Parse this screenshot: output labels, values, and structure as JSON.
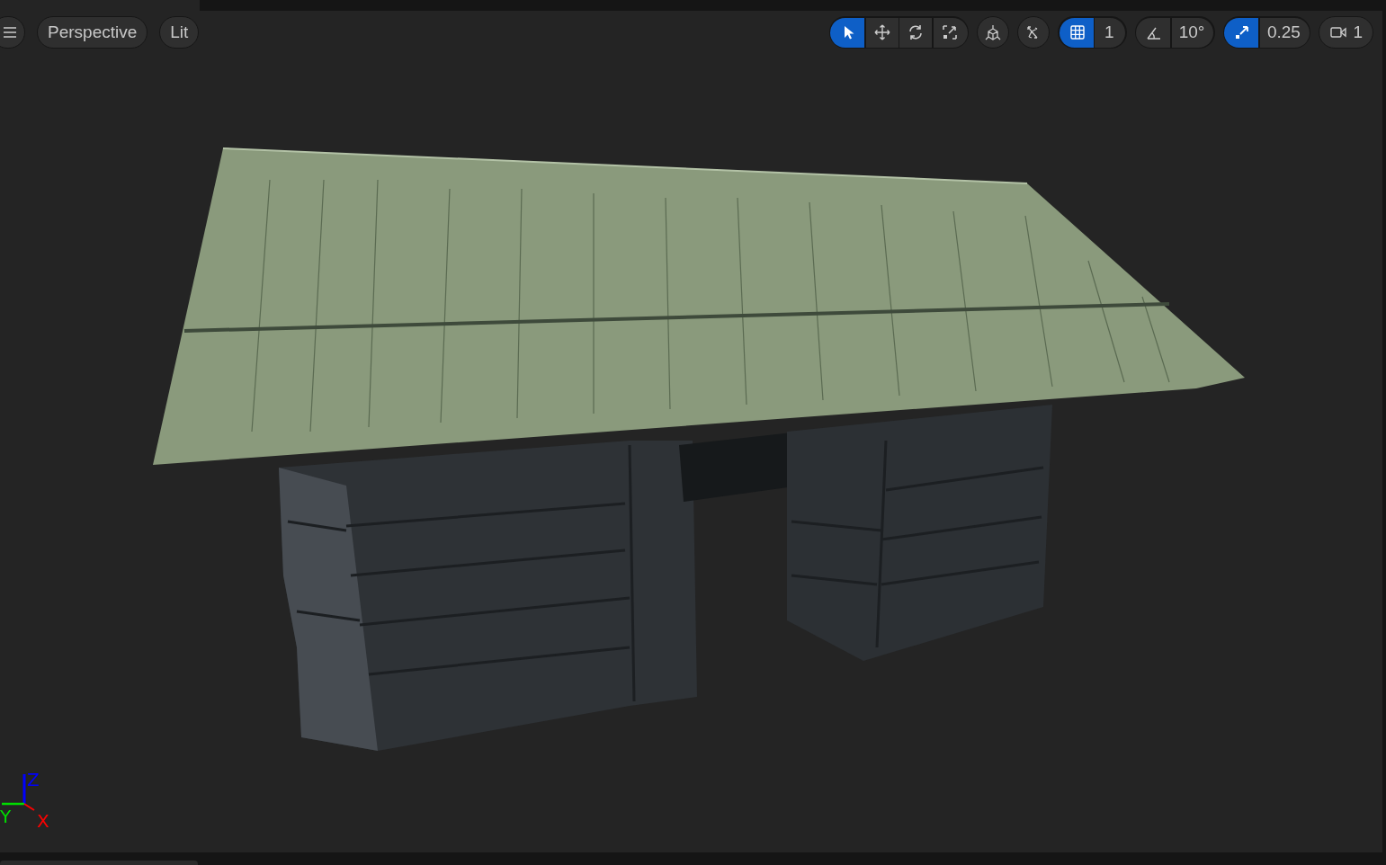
{
  "toolbar": {
    "left": [
      {
        "kind": "menu"
      },
      {
        "kind": "text",
        "label": "Perspective"
      },
      {
        "kind": "text",
        "label": "Lit"
      }
    ],
    "transform_tools": [
      {
        "kind": "select",
        "selected": true
      },
      {
        "kind": "move",
        "selected": false
      },
      {
        "kind": "rotate",
        "selected": false
      },
      {
        "kind": "scale",
        "selected": false
      }
    ],
    "extra_tools": [
      {
        "kind": "cube-axes"
      },
      {
        "kind": "scatter-arrows"
      }
    ],
    "snaps": [
      {
        "kind": "grid",
        "on": true,
        "value": "1"
      },
      {
        "kind": "angle",
        "on": false,
        "value": "10°"
      },
      {
        "kind": "scale",
        "on": true,
        "value": "0.25"
      }
    ],
    "camera_speed": {
      "value": "1"
    }
  },
  "axis_gizmo": [
    {
      "label": "Z",
      "color": "#0000ff"
    },
    {
      "label": "Y",
      "color": "#00dd00"
    },
    {
      "label": "X",
      "color": "#ff0000"
    }
  ]
}
